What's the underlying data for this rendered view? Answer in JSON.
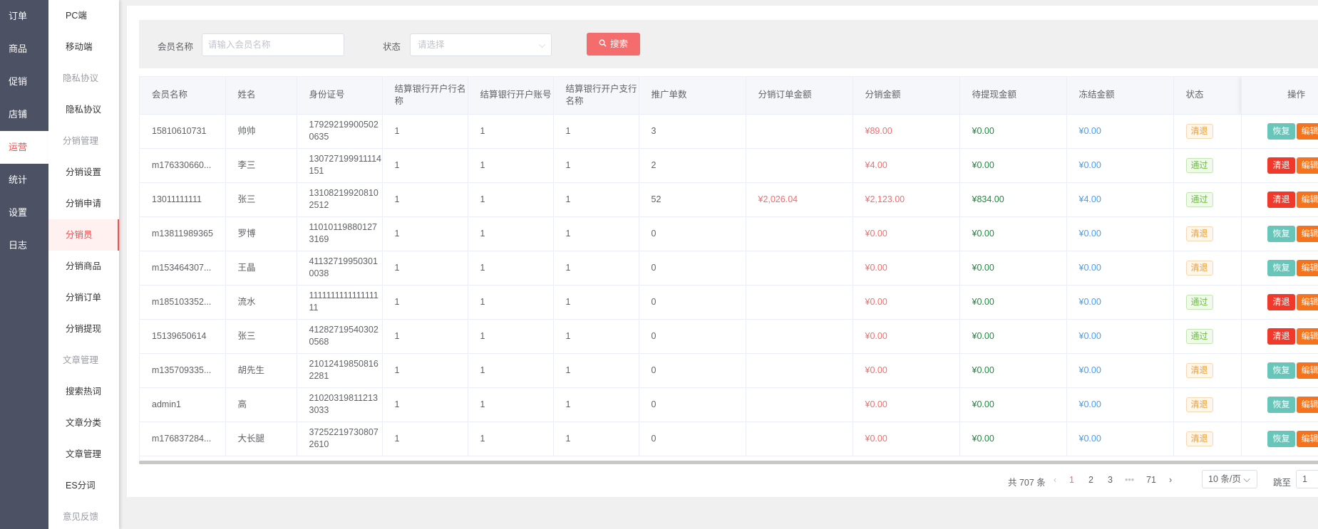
{
  "nav_primary": [
    "订单",
    "商品",
    "促销",
    "店铺",
    "运营",
    "统计",
    "设置",
    "日志"
  ],
  "nav_primary_active": 4,
  "nav_secondary": [
    {
      "label": "PC端",
      "type": "link"
    },
    {
      "label": "移动端",
      "type": "link"
    },
    {
      "label": "隐私协议",
      "type": "group"
    },
    {
      "label": "隐私协议",
      "type": "link"
    },
    {
      "label": "分销管理",
      "type": "group"
    },
    {
      "label": "分销设置",
      "type": "link"
    },
    {
      "label": "分销申请",
      "type": "link"
    },
    {
      "label": "分销员",
      "type": "link",
      "active": true
    },
    {
      "label": "分销商品",
      "type": "link"
    },
    {
      "label": "分销订单",
      "type": "link"
    },
    {
      "label": "分销提现",
      "type": "link"
    },
    {
      "label": "文章管理",
      "type": "group"
    },
    {
      "label": "搜索热词",
      "type": "link"
    },
    {
      "label": "文章分类",
      "type": "link"
    },
    {
      "label": "文章管理",
      "type": "link"
    },
    {
      "label": "ES分词",
      "type": "link"
    },
    {
      "label": "意见反馈",
      "type": "group"
    }
  ],
  "search": {
    "member_label": "会员名称",
    "member_placeholder": "请输入会员名称",
    "status_label": "状态",
    "status_placeholder": "请选择",
    "button": "搜索"
  },
  "table": {
    "headers": [
      "会员名称",
      "姓名",
      "身份证号",
      "结算银行开户行名称",
      "结算银行开户账号",
      "结算银行开户支行名称",
      "推广单数",
      "分销订单金额",
      "分销金额",
      "待提现金额",
      "冻结金额",
      "状态",
      "操作"
    ],
    "rows": [
      {
        "member": "15810610731",
        "name": "帅帅",
        "id": "179292199005020635",
        "bank": "1",
        "account": "1",
        "branch": "1",
        "orders": "3",
        "order_amt": "",
        "dist_amt": "¥89.00",
        "pending": "¥0.00",
        "frozen": "¥0.00",
        "status": "清退",
        "status_type": "clear",
        "action1": "恢复",
        "action1_type": "restore",
        "action2": "编辑"
      },
      {
        "member": "m176330660...",
        "name": "李三",
        "id": "130727199911114151",
        "bank": "1",
        "account": "1",
        "branch": "1",
        "orders": "2",
        "order_amt": "",
        "dist_amt": "¥4.00",
        "pending": "¥0.00",
        "frozen": "¥0.00",
        "status": "通过",
        "status_type": "pass",
        "action1": "清退",
        "action1_type": "clearbtn",
        "action2": "编辑"
      },
      {
        "member": "13011111111",
        "name": "张三",
        "id": "131082199208102512",
        "bank": "1",
        "account": "1",
        "branch": "1",
        "orders": "52",
        "order_amt": "¥2,026.04",
        "dist_amt": "¥2,123.00",
        "pending": "¥834.00",
        "frozen": "¥4.00",
        "status": "通过",
        "status_type": "pass",
        "action1": "清退",
        "action1_type": "clearbtn",
        "action2": "编辑"
      },
      {
        "member": "m13811989365",
        "name": "罗博",
        "id": "110101198801273169",
        "bank": "1",
        "account": "1",
        "branch": "1",
        "orders": "0",
        "order_amt": "",
        "dist_amt": "¥0.00",
        "pending": "¥0.00",
        "frozen": "¥0.00",
        "status": "清退",
        "status_type": "clear",
        "action1": "恢复",
        "action1_type": "restore",
        "action2": "编辑"
      },
      {
        "member": "m153464307...",
        "name": "王晶",
        "id": "411327199503010038",
        "bank": "1",
        "account": "1",
        "branch": "1",
        "orders": "0",
        "order_amt": "",
        "dist_amt": "¥0.00",
        "pending": "¥0.00",
        "frozen": "¥0.00",
        "status": "清退",
        "status_type": "clear",
        "action1": "恢复",
        "action1_type": "restore",
        "action2": "编辑"
      },
      {
        "member": "m185103352...",
        "name": "流水",
        "id": "111111111111111111",
        "bank": "1",
        "account": "1",
        "branch": "1",
        "orders": "0",
        "order_amt": "",
        "dist_amt": "¥0.00",
        "pending": "¥0.00",
        "frozen": "¥0.00",
        "status": "通过",
        "status_type": "pass",
        "action1": "清退",
        "action1_type": "clearbtn",
        "action2": "编辑"
      },
      {
        "member": "15139650614",
        "name": "张三",
        "id": "412827195403020568",
        "bank": "1",
        "account": "1",
        "branch": "1",
        "orders": "0",
        "order_amt": "",
        "dist_amt": "¥0.00",
        "pending": "¥0.00",
        "frozen": "¥0.00",
        "status": "通过",
        "status_type": "pass",
        "action1": "清退",
        "action1_type": "clearbtn",
        "action2": "编辑"
      },
      {
        "member": "m135709335...",
        "name": "胡先生",
        "id": "210124198508162281",
        "bank": "1",
        "account": "1",
        "branch": "1",
        "orders": "0",
        "order_amt": "",
        "dist_amt": "¥0.00",
        "pending": "¥0.00",
        "frozen": "¥0.00",
        "status": "清退",
        "status_type": "clear",
        "action1": "恢复",
        "action1_type": "restore",
        "action2": "编辑"
      },
      {
        "member": "admin1",
        "name": "高",
        "id": "210203198112133033",
        "bank": "1",
        "account": "1",
        "branch": "1",
        "orders": "0",
        "order_amt": "",
        "dist_amt": "¥0.00",
        "pending": "¥0.00",
        "frozen": "¥0.00",
        "status": "清退",
        "status_type": "clear",
        "action1": "恢复",
        "action1_type": "restore",
        "action2": "编辑"
      },
      {
        "member": "m176837284...",
        "name": "大长腿",
        "id": "372522197308072610",
        "bank": "1",
        "account": "1",
        "branch": "1",
        "orders": "0",
        "order_amt": "",
        "dist_amt": "¥0.00",
        "pending": "¥0.00",
        "frozen": "¥0.00",
        "status": "清退",
        "status_type": "clear",
        "action1": "恢复",
        "action1_type": "restore",
        "action2": "编辑"
      }
    ]
  },
  "pagination": {
    "total": "共 707 条",
    "pages": [
      "1",
      "2",
      "3",
      "71"
    ],
    "current": "1",
    "ellipsis": "•••",
    "page_size": "10 条/页",
    "jump_label": "跳至",
    "jump_value": "1"
  },
  "colors": {
    "accent": "#f14e4e",
    "nav_bg": "#4c5264",
    "pass": "#67c23a",
    "clear": "#e6a23c",
    "restore_btn": "#67c6b9",
    "clear_btn": "#f0392b",
    "edit_btn": "#f5731c"
  }
}
